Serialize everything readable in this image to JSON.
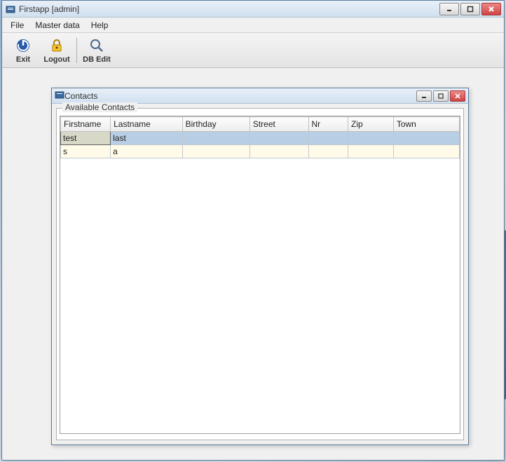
{
  "main_window": {
    "title": "Firstapp [admin]"
  },
  "menu": {
    "items": [
      "File",
      "Master data",
      "Help"
    ]
  },
  "toolbar": {
    "exit": "Exit",
    "logout": "Logout",
    "dbedit": "DB Edit"
  },
  "inner_window": {
    "title": "Contacts",
    "group_label": "Available Contacts"
  },
  "table": {
    "columns": [
      "Firstname",
      "Lastname",
      "Birthday",
      "Street",
      "Nr",
      "Zip",
      "Town"
    ],
    "rows": [
      {
        "firstname": "test",
        "lastname": "last",
        "birthday": "",
        "street": "",
        "nr": "",
        "zip": "",
        "town": "",
        "selected": true
      },
      {
        "firstname": "s",
        "lastname": "a",
        "birthday": "",
        "street": "",
        "nr": "",
        "zip": "",
        "town": "",
        "selected": false
      }
    ]
  }
}
